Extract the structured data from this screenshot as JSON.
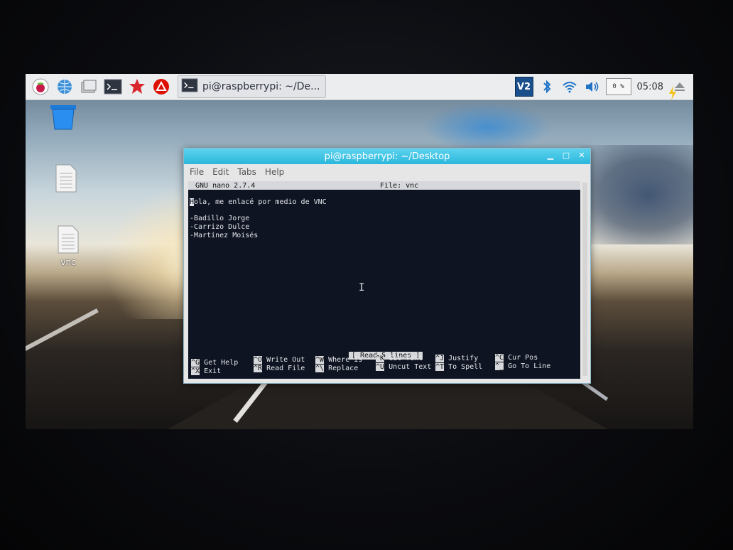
{
  "taskbar": {
    "icons": [
      "raspberry-menu-icon",
      "web-browser-icon",
      "file-manager-icon",
      "terminal-icon",
      "mathematica-icon",
      "wolfram-icon"
    ],
    "task_label": "pi@raspberrypi: ~/De...",
    "tray": {
      "vnc_label": "V2",
      "cpu": "0 %",
      "clock": "05:08"
    }
  },
  "desktop": {
    "icons": [
      {
        "name": "trash",
        "label": ""
      },
      {
        "name": "document",
        "label": ""
      },
      {
        "name": "vnc-file",
        "label": "vnc"
      }
    ]
  },
  "window": {
    "title": "pi@raspberrypi: ~/Desktop",
    "menu": [
      "File",
      "Edit",
      "Tabs",
      "Help"
    ]
  },
  "nano": {
    "version": "GNU nano 2.7.4",
    "file": "File: vnc",
    "first_char": "H",
    "first_rest": "ola, me enlacé por medio de VNC",
    "lines": [
      "-Badillo Jorge",
      "-Carrizo Dulce",
      "-Martínez Moisés"
    ],
    "status": "[ Read 5 lines ]",
    "shortcuts": [
      {
        "key": "^G",
        "label": "Get Help"
      },
      {
        "key": "^O",
        "label": "Write Out"
      },
      {
        "key": "^W",
        "label": "Where Is"
      },
      {
        "key": "^K",
        "label": "Cut Text"
      },
      {
        "key": "^J",
        "label": "Justify"
      },
      {
        "key": "^C",
        "label": "Cur Pos"
      },
      {
        "key": "^X",
        "label": "Exit"
      },
      {
        "key": "^R",
        "label": "Read File"
      },
      {
        "key": "^\\",
        "label": "Replace"
      },
      {
        "key": "^U",
        "label": "Uncut Text"
      },
      {
        "key": "^T",
        "label": "To Spell"
      },
      {
        "key": "^_",
        "label": "Go To Line"
      }
    ]
  }
}
